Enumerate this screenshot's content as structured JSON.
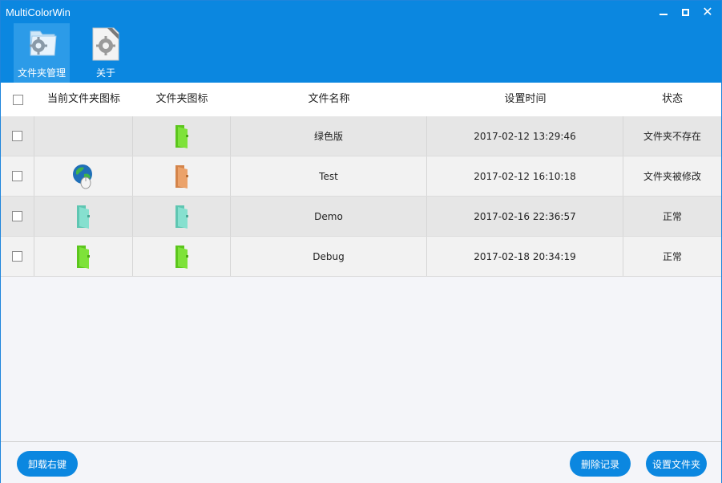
{
  "window": {
    "title": "MultiColorWin"
  },
  "nav": [
    {
      "label": "文件夹管理",
      "icon": "folder-settings-icon",
      "active": true
    },
    {
      "label": "关于",
      "icon": "about-icon",
      "active": false
    }
  ],
  "grid": {
    "headers": [
      "当前文件夹图标",
      "文件夹图标",
      "文件名称",
      "设置时间",
      "状态"
    ],
    "rows": [
      {
        "current_icon": "none",
        "folder_icon": "green-folder-icon",
        "name": "绿色版",
        "time": "2017-02-12 13:29:46",
        "status": "文件夹不存在"
      },
      {
        "current_icon": "globe-icon",
        "folder_icon": "orange-folder-icon",
        "name": "Test",
        "time": "2017-02-12 16:10:18",
        "status": "文件夹被修改"
      },
      {
        "current_icon": "teal-folder-icon",
        "folder_icon": "teal-folder-icon",
        "name": "Demo",
        "time": "2017-02-16 22:36:57",
        "status": "正常"
      },
      {
        "current_icon": "green-folder-icon",
        "folder_icon": "green-folder-icon",
        "name": "Debug",
        "time": "2017-02-18 20:34:19",
        "status": "正常"
      }
    ]
  },
  "buttons": {
    "uninstall": "卸载右键",
    "delete": "删除记录",
    "set_folder": "设置文件夹"
  },
  "colors": {
    "accent": "#0b87e0",
    "green_folder": "#6dd92a",
    "orange_folder": "#e39a5c",
    "teal_folder": "#7fdccb"
  }
}
